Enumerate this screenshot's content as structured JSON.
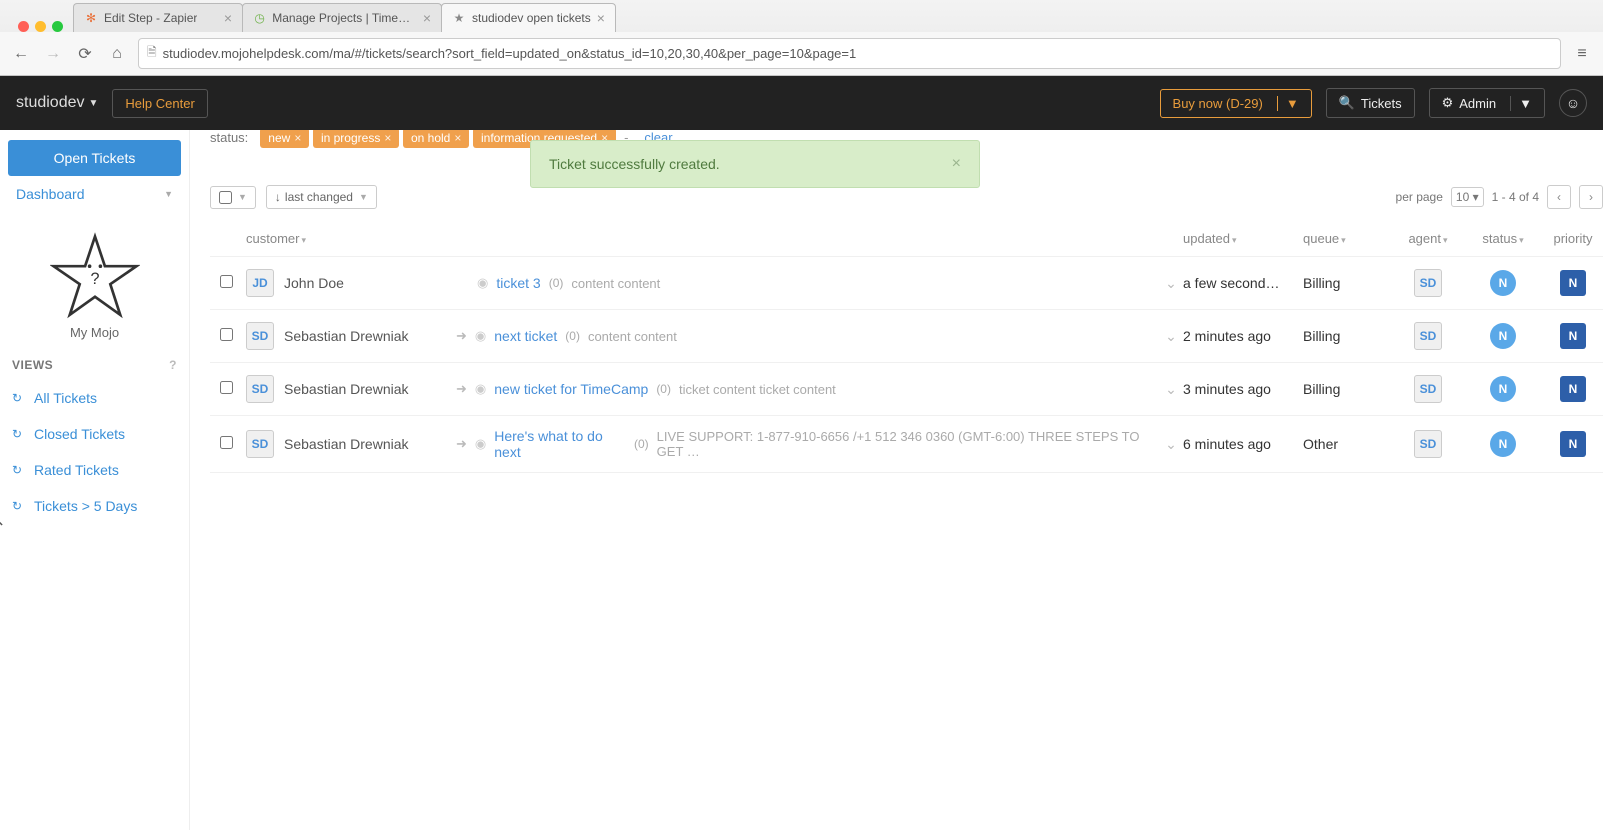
{
  "browser": {
    "tabs": [
      {
        "title": "Edit Step - Zapier",
        "favicon": "✻",
        "favicon_color": "#e8733e",
        "active": false
      },
      {
        "title": "Manage Projects | TimeCa…",
        "favicon": "◷",
        "favicon_color": "#6fb24a",
        "active": false
      },
      {
        "title": "studiodev open tickets",
        "favicon": "★",
        "favicon_color": "#8a8a8a",
        "active": true
      }
    ],
    "url": "studiodev.mojohelpdesk.com/ma/#/tickets/search?sort_field=updated_on&status_id=10,20,30,40&per_page=10&page=1"
  },
  "appbar": {
    "brand": "studiodev",
    "help_center": "Help Center",
    "buy_now": "Buy now (D-29)",
    "tickets": "Tickets",
    "admin": "Admin"
  },
  "sidebar": {
    "open_tickets": "Open Tickets",
    "dashboard": "Dashboard",
    "my_mojo": "My Mojo",
    "views_header": "VIEWS",
    "views": [
      "All Tickets",
      "Closed Tickets",
      "Rated Tickets",
      "Tickets > 5 Days"
    ]
  },
  "filters": {
    "label": "status:",
    "tags": [
      "new",
      "in progress",
      "on hold",
      "information requested"
    ],
    "clear": "clear"
  },
  "alert": {
    "text": "Ticket successfully created."
  },
  "toolbar": {
    "sort": "last changed",
    "per_page_label": "per page",
    "per_page_value": "10",
    "range": "1 - 4 of 4"
  },
  "columns": {
    "customer": "customer",
    "updated": "updated",
    "queue": "queue",
    "agent": "agent",
    "status": "status",
    "priority": "priority"
  },
  "rows": [
    {
      "avatar": "JD",
      "customer": "John Doe",
      "forwarded": false,
      "title": "ticket 3",
      "count": "(0)",
      "preview": "content content",
      "updated": "a few second…",
      "queue": "Billing",
      "agent": "SD",
      "status": "N",
      "priority": "N"
    },
    {
      "avatar": "SD",
      "customer": "Sebastian Drewniak",
      "forwarded": true,
      "title": "next ticket",
      "count": "(0)",
      "preview": "content content",
      "updated": "2 minutes ago",
      "queue": "Billing",
      "agent": "SD",
      "status": "N",
      "priority": "N"
    },
    {
      "avatar": "SD",
      "customer": "Sebastian Drewniak",
      "forwarded": true,
      "title": "new ticket for TimeCamp",
      "count": "(0)",
      "preview": "ticket content ticket content",
      "updated": "3 minutes ago",
      "queue": "Billing",
      "agent": "SD",
      "status": "N",
      "priority": "N"
    },
    {
      "avatar": "SD",
      "customer": "Sebastian Drewniak",
      "forwarded": true,
      "title": "Here's what to do next",
      "count": "(0)",
      "preview": "LIVE SUPPORT: 1-877-910-6656 /+1 512 346 0360 (GMT-6:00) THREE STEPS TO GET …",
      "updated": "6 minutes ago",
      "queue": "Other",
      "agent": "SD",
      "status": "N",
      "priority": "N"
    }
  ]
}
